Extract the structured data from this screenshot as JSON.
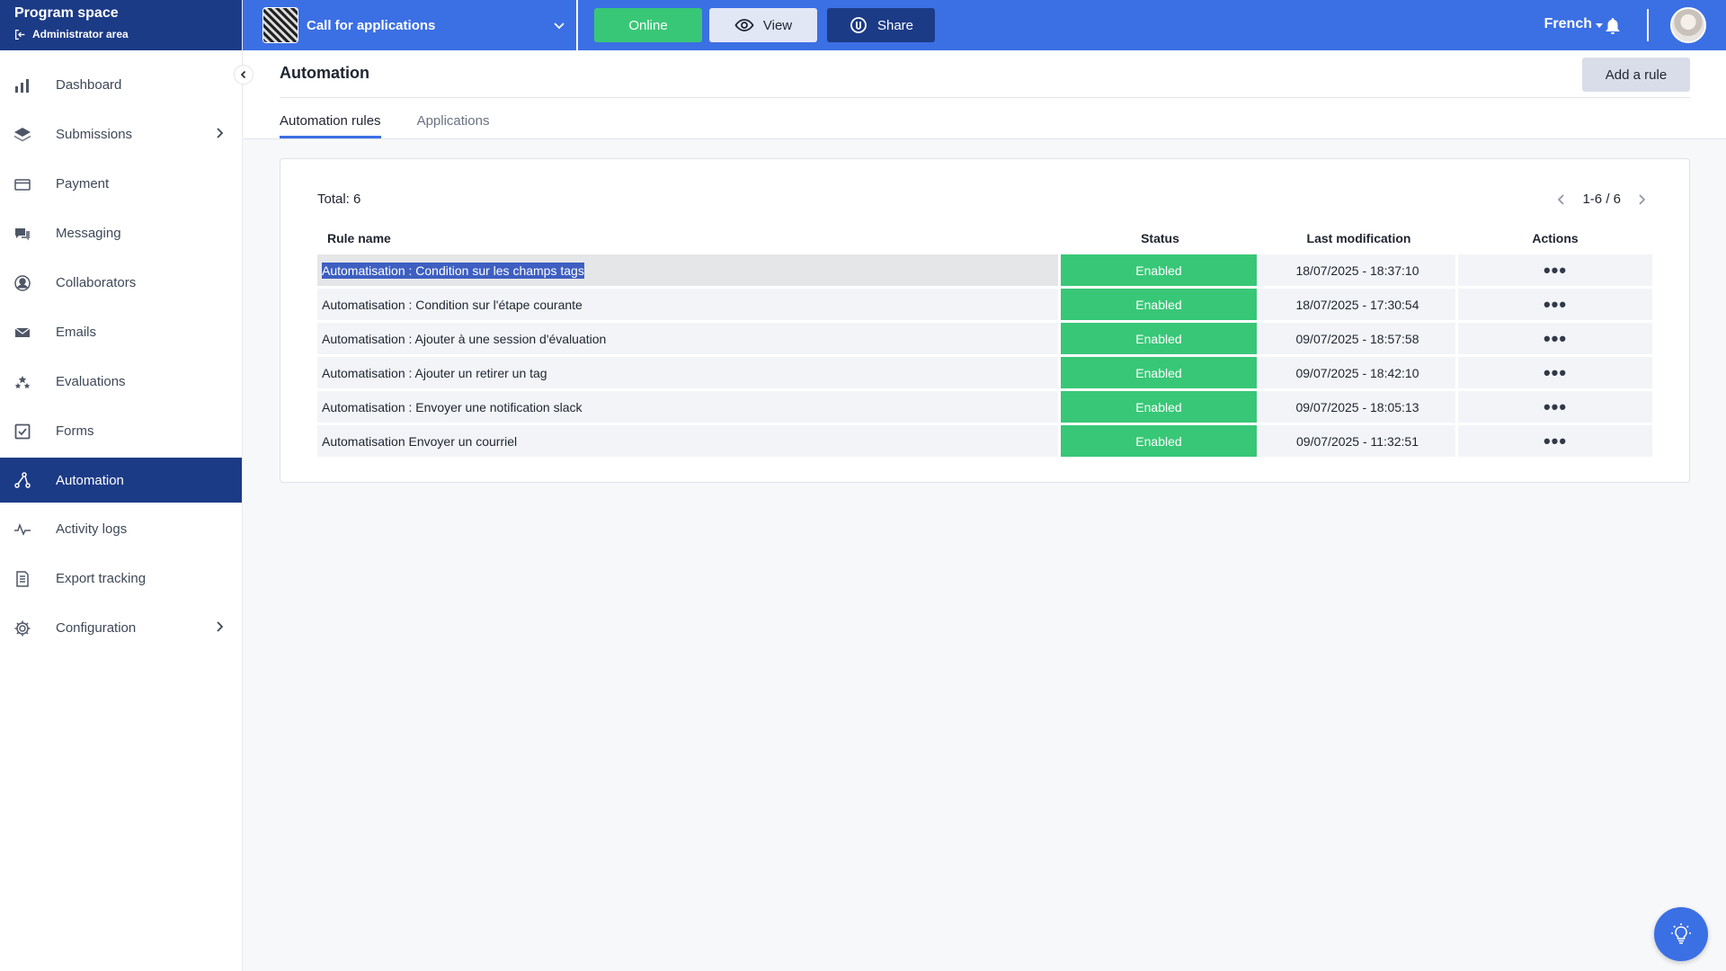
{
  "brand": {
    "title": "Program space",
    "subtitle": "Administrator area"
  },
  "sidebar": {
    "items": [
      {
        "label": "Dashboard",
        "icon": "bar-chart-icon",
        "has_submenu": false
      },
      {
        "label": "Submissions",
        "icon": "layers-icon",
        "has_submenu": true
      },
      {
        "label": "Payment",
        "icon": "credit-card-icon",
        "has_submenu": false
      },
      {
        "label": "Messaging",
        "icon": "chat-icon",
        "has_submenu": false
      },
      {
        "label": "Collaborators",
        "icon": "user-circle-icon",
        "has_submenu": false
      },
      {
        "label": "Emails",
        "icon": "envelope-icon",
        "has_submenu": false
      },
      {
        "label": "Evaluations",
        "icon": "stars-icon",
        "has_submenu": false
      },
      {
        "label": "Forms",
        "icon": "checkbox-icon",
        "has_submenu": false
      },
      {
        "label": "Automation",
        "icon": "automation-icon",
        "has_submenu": false,
        "active": true
      },
      {
        "label": "Activity logs",
        "icon": "activity-icon",
        "has_submenu": false
      },
      {
        "label": "Export tracking",
        "icon": "document-icon",
        "has_submenu": false
      },
      {
        "label": "Configuration",
        "icon": "gear-icon",
        "has_submenu": true
      }
    ]
  },
  "topbar": {
    "campaign_name": "Call for applications",
    "online_label": "Online",
    "view_label": "View",
    "share_label": "Share",
    "language": "French"
  },
  "page": {
    "title": "Automation",
    "add_button_label": "Add a rule",
    "tabs": [
      {
        "label": "Automation rules",
        "active": true
      },
      {
        "label": "Applications",
        "active": false
      }
    ]
  },
  "table": {
    "total_label": "Total: 6",
    "pagination": "1-6 / 6",
    "columns": [
      "Rule name",
      "Status",
      "Last modification",
      "Actions"
    ],
    "rows": [
      {
        "name": "Automatisation : Condition sur les champs tags",
        "status": "Enabled",
        "modified": "18/07/2025 - 18:37:10",
        "actions": "•••"
      },
      {
        "name": "Automatisation : Condition sur l'étape courante",
        "status": "Enabled",
        "modified": "18/07/2025 - 17:30:54",
        "actions": "•••"
      },
      {
        "name": "Automatisation : Ajouter à une session d'évaluation",
        "status": "Enabled",
        "modified": "09/07/2025 - 18:57:58",
        "actions": "•••"
      },
      {
        "name": "Automatisation : Ajouter un retirer un tag",
        "status": "Enabled",
        "modified": "09/07/2025 - 18:42:10",
        "actions": "•••"
      },
      {
        "name": "Automatisation : Envoyer une notification slack",
        "status": "Enabled",
        "modified": "09/07/2025 - 18:05:13",
        "actions": "•••"
      },
      {
        "name": "Automatisation Envoyer un courriel",
        "status": "Enabled",
        "modified": "09/07/2025 - 11:32:51",
        "actions": "•••"
      }
    ]
  },
  "colors": {
    "brand_dark": "#1c3b86",
    "topbar_blue": "#3b6fe4",
    "enabled_green": "#38c777",
    "selection": "#3e5fc1"
  }
}
